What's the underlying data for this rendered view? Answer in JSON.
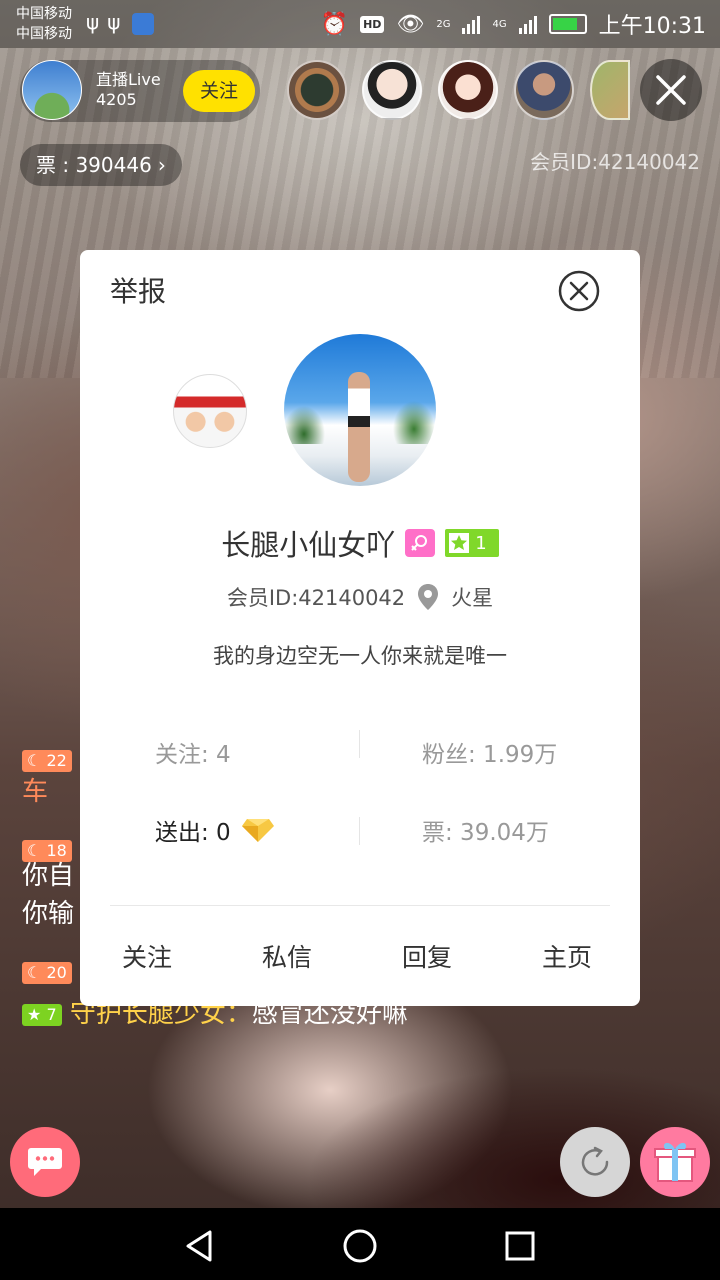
{
  "status_bar": {
    "carrier_1": "中国移动",
    "carrier_2": "中国移动",
    "net_2g": "2G",
    "net_4g": "4G",
    "hd": "HD",
    "time": "上午10:31"
  },
  "anchor": {
    "title": "直播Live",
    "number": "4205",
    "follow_label": "关注",
    "tickets": "票 : 390446",
    "member_id": "会员ID:42140042"
  },
  "chat": [
    {
      "level": "22",
      "text": "车"
    },
    {
      "level": "18",
      "text": "你自"
    },
    {
      "level": "",
      "text": "你输"
    },
    {
      "level": "20",
      "text": ""
    },
    {
      "level": "7",
      "name": "守护长腿少女：",
      "text": "感冒还没好嘛"
    }
  ],
  "profile_dialog": {
    "title": "举报",
    "nickname": "长腿小仙女吖",
    "level": "1",
    "member_id": "会员ID:42140042",
    "location": "火星",
    "signature": "我的身边空无一人你来就是唯一",
    "stats": {
      "following": "关注: 4",
      "fans": "粉丝: 1.99万",
      "sent": "送出: 0",
      "tickets": "票: 39.04万"
    },
    "actions": {
      "follow": "关注",
      "message": "私信",
      "reply": "回复",
      "homepage": "主页"
    }
  },
  "colors": {
    "follow_yellow": "#ffe100",
    "level_green": "#80d82a",
    "gender_pink": "#ff6fc8",
    "chat_button": "#ff6b7a",
    "gift_button": "#ff7aa0"
  }
}
